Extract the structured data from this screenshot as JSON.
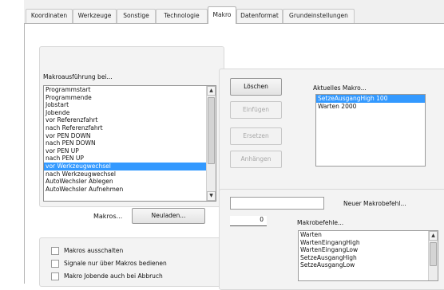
{
  "tabs": [
    {
      "label": "Koordinaten"
    },
    {
      "label": "Werkzeuge"
    },
    {
      "label": "Sonstige"
    },
    {
      "label": "Technologie"
    },
    {
      "label": "Makro"
    },
    {
      "label": "Datenformat"
    },
    {
      "label": "Grundeinstellungen"
    }
  ],
  "active_tab": "Makro",
  "macro_execution": {
    "label": "Makroausführung bei...",
    "items": [
      "Programmstart",
      "Programmende",
      "Jobstart",
      "Jobende",
      "vor Referenzfahrt",
      "nach Referenzfahrt",
      "vor PEN DOWN",
      "nach PEN DOWN",
      "vor PEN UP",
      "nach PEN UP",
      "vor Werkzeugwechsel",
      "nach Werkzeugwechsel",
      "AutoWechsler Ablegen",
      "AutoWechsler Aufnehmen"
    ],
    "selected": "vor Werkzeugwechsel"
  },
  "macros_row": {
    "label": "Makros...",
    "new_button": "Neuladen..."
  },
  "options": [
    {
      "label": "Makros ausschalten",
      "checked": false
    },
    {
      "label": "Signale nur über Makros bedienen",
      "checked": false
    },
    {
      "label": "Makro Jobende auch bei Abbruch",
      "checked": false
    }
  ],
  "actions": {
    "delete": "Löschen",
    "insert": "Einfügen",
    "replace": "Ersetzen",
    "append": "Anhängen"
  },
  "current_macro": {
    "label": "Aktuelles Makro...",
    "items": [
      "SetzeAusgangHigh 100",
      "Warten 2000"
    ],
    "selected": "SetzeAusgangHigh 100"
  },
  "new_command": {
    "label": "Neuer Makrobefehl...",
    "value": ""
  },
  "parameter": {
    "value": "0"
  },
  "commands": {
    "label": "Makrobefehle...",
    "items": [
      "Warten",
      "WartenEingangHigh",
      "WartenEingangLow",
      "SetzeAusgangHigh",
      "SetzeAusgangLow"
    ]
  }
}
